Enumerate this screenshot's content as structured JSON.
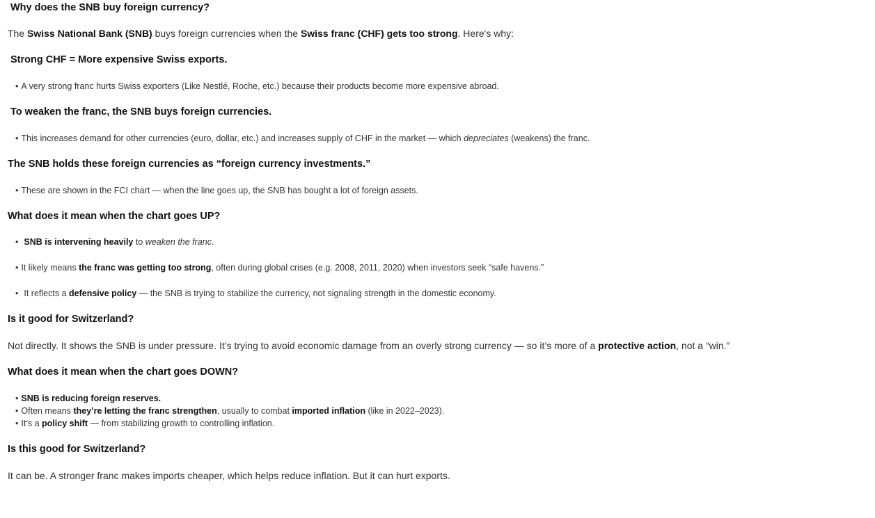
{
  "doc": {
    "h1": "Why does the SNB buy foreign currency?",
    "intro": {
      "t1": "The ",
      "b1": "Swiss National Bank (SNB)",
      "t2": " buys foreign currencies when the ",
      "b2": "Swiss franc (CHF) gets too strong",
      "t3": ". Here's why:"
    },
    "h2": "Strong CHF = More expensive Swiss exports.",
    "bullet1": "A very strong franc hurts Swiss exporters (Like Nestlé, Roche, etc.) because their products become more expensive abroad.",
    "h3": "To weaken the franc, the SNB buys foreign currencies.",
    "bullet2": {
      "t1": "This increases demand for other currencies (euro, dollar, etc.) and increases supply of CHF in the market — which ",
      "em": "depreciates",
      "t2": " (weakens) the franc."
    },
    "h4": "The SNB holds these foreign currencies as “foreign currency investments.”",
    "bullet3": "These are shown in the FCI chart — when the line goes up, the SNB has bought a lot of foreign assets.",
    "h5": "What does it mean when the chart goes UP?",
    "up_bullets": {
      "b1": {
        "strong": "SNB is intervening heavily",
        "t1": " to ",
        "em": "weaken the franc",
        "t2": "."
      },
      "b2": {
        "t1": "It likely means ",
        "strong": "the franc was getting too strong",
        "t2": ", often during global crises (e.g. 2008, 2011, 2020) when investors seek “safe havens.”"
      },
      "b3": {
        "t1": "It reflects a ",
        "strong": "defensive policy",
        "t2": " — the SNB is trying to stabilize the currency, not signaling strength in the domestic economy."
      }
    },
    "h6": "Is it good for Switzerland?",
    "p_good": {
      "t1": "Not directly. It shows the SNB is under pressure. It’s trying to avoid economic damage from an overly strong currency — so it’s more of a ",
      "strong": "protective action",
      "t2": ", not a “win.”"
    },
    "h7": "What does it mean when the chart goes DOWN?",
    "down_bullets": {
      "b1": {
        "strong": "SNB is reducing foreign reserves."
      },
      "b2": {
        "t1": "Often means ",
        "strong1": "they’re letting the franc strengthen",
        "t2": ", usually to combat ",
        "strong2": "imported inflation",
        "t3": " (like in 2022–2023)."
      },
      "b3": {
        "t1": "It’s a ",
        "strong": "policy shift",
        "t2": " — from stabilizing growth to controlling inflation."
      }
    },
    "h8": "Is this good for Switzerland?",
    "p_final": "It can be. A stronger franc makes imports cheaper, which helps reduce inflation. But it can hurt exports.",
    "bullet_glyph": "•"
  }
}
